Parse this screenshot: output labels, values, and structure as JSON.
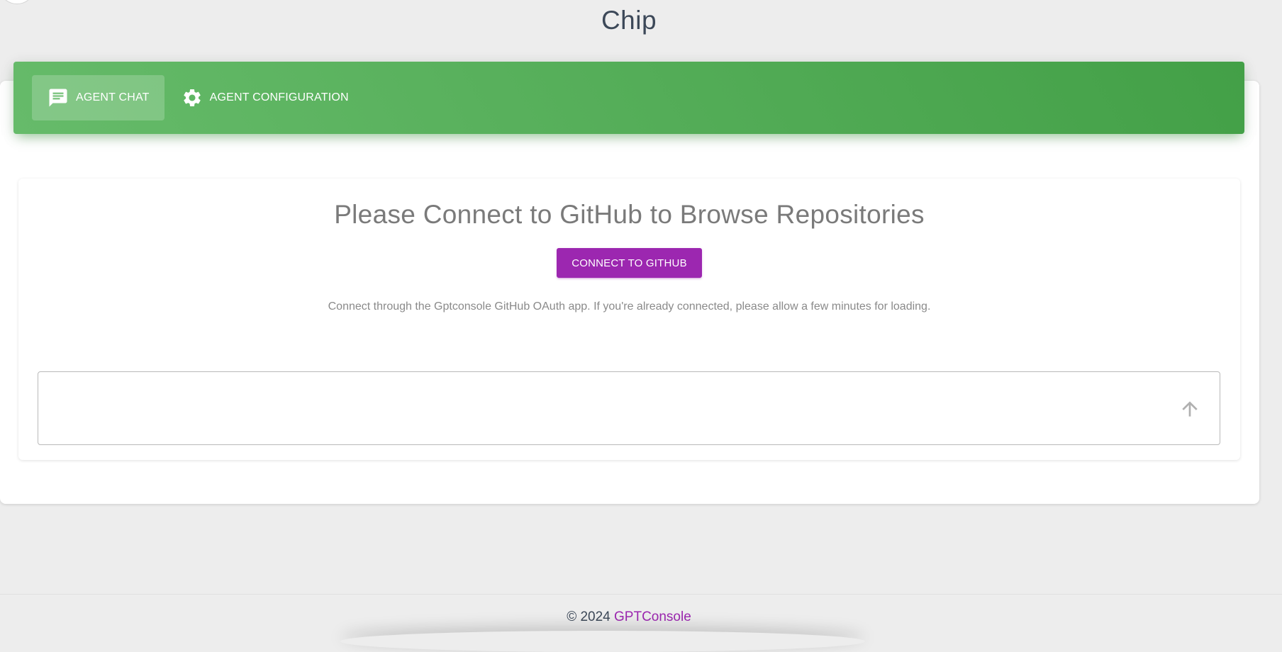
{
  "page": {
    "title": "Chip"
  },
  "tabs": [
    {
      "label": "AGENT CHAT",
      "icon": "chat-icon",
      "active": true
    },
    {
      "label": "AGENT CONFIGURATION",
      "icon": "gear-icon",
      "active": false
    }
  ],
  "main": {
    "heading": "Please Connect to GitHub to Browse Repositories",
    "connect_button_label": "CONNECT TO GITHUB",
    "note": "Connect through the Gptconsole GitHub OAuth app. If you're already connected, please allow a few minutes for loading.",
    "chat_input": {
      "value": "",
      "placeholder": ""
    },
    "send_icon": "arrow-up-icon"
  },
  "footer": {
    "copyright": "© 2024",
    "brand": "GPTConsole"
  },
  "colors": {
    "header_gradient_start": "#66bb6a",
    "header_gradient_end": "#43a047",
    "accent": "#9c27b0",
    "background": "#ededed"
  }
}
